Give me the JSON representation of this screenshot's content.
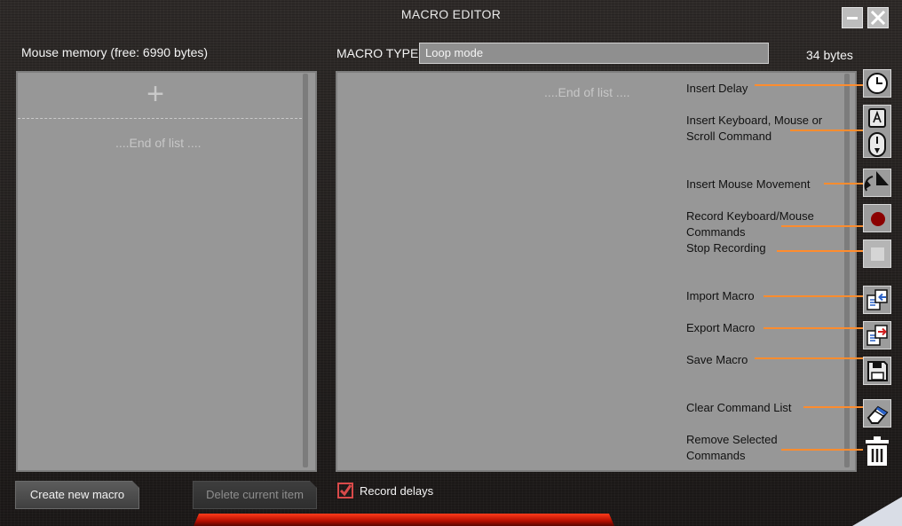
{
  "window": {
    "title": "MACRO EDITOR"
  },
  "left": {
    "memory_label": "Mouse memory (free: 6990 bytes)",
    "add_symbol": "+",
    "end_of_list": "....End of list ...."
  },
  "macro_type": {
    "label": "MACRO TYPE",
    "value": "Loop mode"
  },
  "bytes": "34 bytes",
  "right": {
    "end_of_list": "....End of list ...."
  },
  "annotations": {
    "insert_delay": "Insert Delay",
    "insert_kb_line1": "Insert Keyboard, Mouse or",
    "insert_kb_line2": "Scroll Command",
    "insert_mouse_movement": "Insert Mouse Movement",
    "record_line1": "Record Keyboard/Mouse",
    "record_line2": "Commands",
    "stop_recording": "Stop Recording",
    "import_macro": "Import Macro",
    "export_macro": "Export Macro",
    "save_macro": "Save Macro",
    "clear_list": "Clear Command List",
    "remove_line1": "Remove Selected",
    "remove_line2": "Commands"
  },
  "buttons": {
    "create": "Create new macro",
    "delete": "Delete current item"
  },
  "record_delays": {
    "label": "Record delays",
    "checked": true
  },
  "colors": {
    "annotation_line": "#ff8c2e",
    "record_dot": "#8b0000",
    "check_mark": "#d94a4a"
  },
  "icons": {
    "toolbar": [
      "clock-icon",
      "keyboard-key-icon",
      "mouse-icon",
      "mouse-movement-icon",
      "record-icon",
      "stop-icon",
      "import-icon",
      "export-icon",
      "floppy-disk-icon",
      "eraser-icon",
      "trash-icon"
    ]
  }
}
